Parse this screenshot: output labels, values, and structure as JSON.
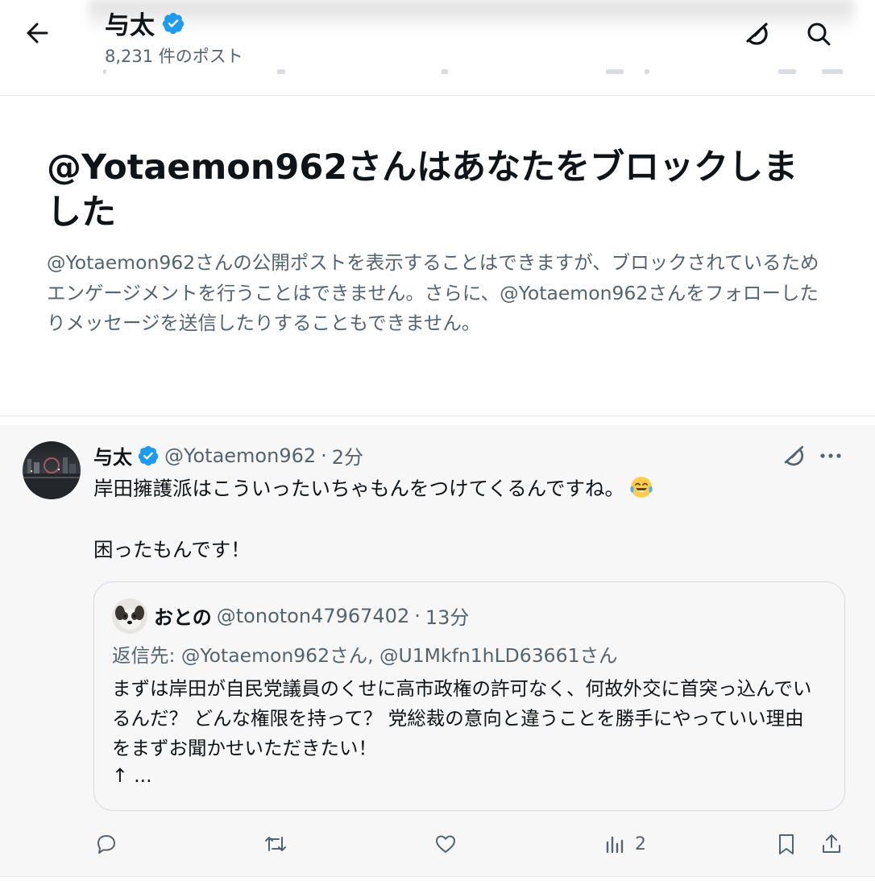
{
  "header": {
    "title": "与太",
    "post_count": "8,231 件のポスト",
    "icons": [
      "back-arrow-icon",
      "verified-badge-icon",
      "grok-icon",
      "search-icon"
    ]
  },
  "block_notice": {
    "title": "@Yotaemon962さんはあなたをブロックしました",
    "description": "@Yotaemon962さんの公開ポストを表示することはできますが、ブロックされているためエンゲージメントを行うことはできません。さらに、@Yotaemon962さんをフォローしたりメッセージを送信したりすることもできません。"
  },
  "tweet": {
    "name": "与太",
    "handle": "@Yotaemon962",
    "dot": "·",
    "time": "2分",
    "text_line1": "岸田擁護派はこういったいちゃもんをつけてくるんですね。",
    "text_line2": "困ったもんです！",
    "emoji": "face-with-tears-of-joy",
    "quote": {
      "name": "おとの",
      "handle": "@tonoton47967402",
      "dot": "·",
      "time": "13分",
      "reply_to": "返信先: @Yotaemon962さん, @U1Mkfn1hLD63661さん",
      "text": "まずは岸田が自民党議員のくせに高市政権の許可なく、何故外交に首突っ込んでいるんだ？ どんな権限を持って？ 党総裁の意向と違うことを勝手にやっていい理由をまずお聞かせいただきたい！",
      "more": "↑ ..."
    },
    "actions": {
      "views_count": "2",
      "icons": [
        "reply-icon",
        "repost-icon",
        "like-icon",
        "views-icon",
        "bookmark-icon",
        "share-icon"
      ]
    }
  },
  "colors": {
    "verified": "#1d9bf0",
    "secondary_text": "#536471",
    "primary_text": "#0f1419",
    "tweet_bg": "#f7f7f8",
    "icon_gray": "#536471"
  }
}
